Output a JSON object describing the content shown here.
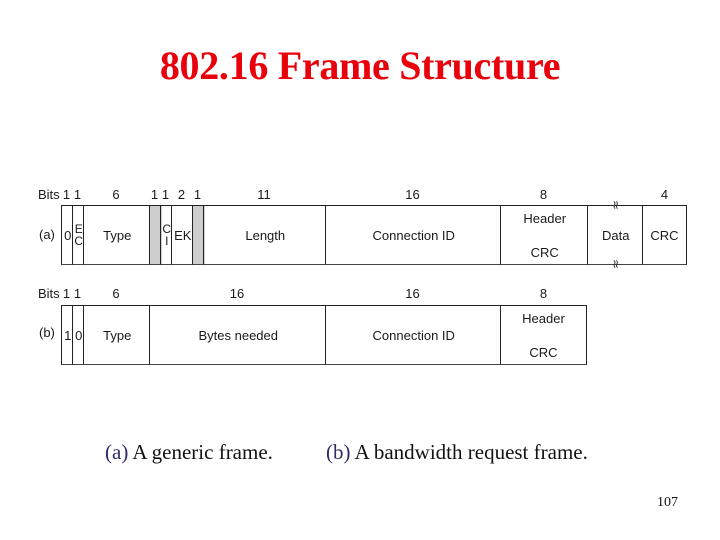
{
  "slide": {
    "title": "802.16 Frame Structure",
    "page_number": "107"
  },
  "diagram": {
    "bits_label": "Bits",
    "frame_a": {
      "label": "(a)",
      "fields": [
        {
          "name": "0",
          "bits": "1",
          "shaded": false
        },
        {
          "name": "EC",
          "display": [
            "E",
            "C"
          ],
          "bits": "1",
          "shaded": false
        },
        {
          "name": "Type",
          "bits": "6",
          "shaded": false
        },
        {
          "name": "",
          "bits": "1",
          "shaded": true
        },
        {
          "name": "CI",
          "display": [
            "C",
            "I"
          ],
          "bits": "1",
          "shaded": false
        },
        {
          "name": "EK",
          "bits": "2",
          "shaded": false
        },
        {
          "name": "",
          "bits": "1",
          "shaded": true
        },
        {
          "name": "Length",
          "bits": "11",
          "shaded": false
        },
        {
          "name": "Connection ID",
          "bits": "16",
          "shaded": false
        },
        {
          "name": "Header CRC",
          "display": [
            "Header",
            "CRC"
          ],
          "bits": "8",
          "shaded": false
        },
        {
          "name": "Data",
          "bits": "",
          "shaded": false,
          "variable_length": true
        },
        {
          "name": "CRC",
          "bits": "4",
          "shaded": false
        }
      ]
    },
    "frame_b": {
      "label": "(b)",
      "fields": [
        {
          "name": "1",
          "bits": "1"
        },
        {
          "name": "0",
          "bits": "1"
        },
        {
          "name": "Type",
          "bits": "6"
        },
        {
          "name": "Bytes needed",
          "bits": "16"
        },
        {
          "name": "Connection ID",
          "bits": "16"
        },
        {
          "name": "Header CRC",
          "display": [
            "Header",
            "CRC"
          ],
          "bits": "8"
        }
      ]
    },
    "squiggle_glyph": "≈"
  },
  "captions": {
    "a_tag": "(a)",
    "a_text": " A generic frame.",
    "b_tag": "(b)",
    "b_text": " A bandwidth request frame."
  }
}
